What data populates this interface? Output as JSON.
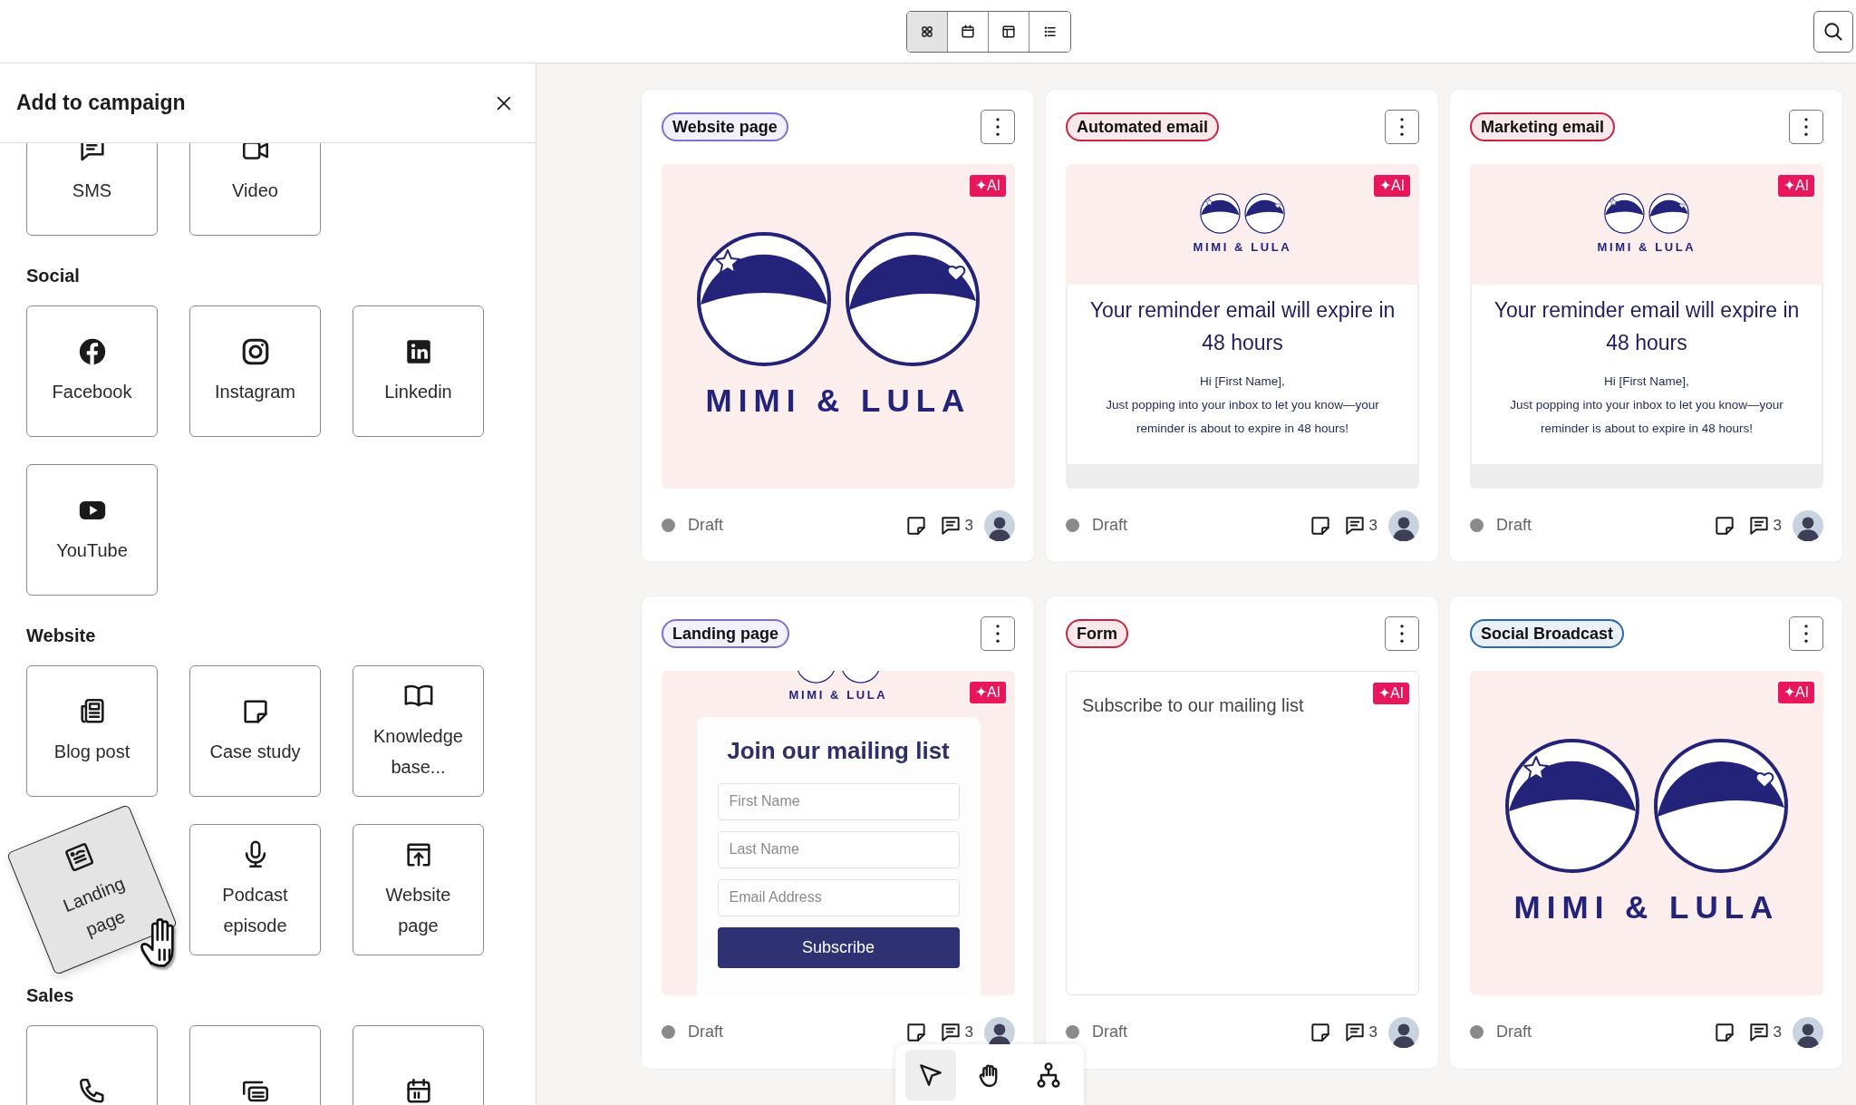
{
  "view_switcher": [
    {
      "selected": true
    },
    {
      "selected": false
    },
    {
      "selected": false
    },
    {
      "selected": false
    }
  ],
  "panel": {
    "title": "Add to campaign",
    "sections": [
      {
        "items": [
          {
            "label": "SMS",
            "dragging": false
          },
          {
            "label": "Video",
            "dragging": false
          }
        ]
      },
      {
        "title": "Social",
        "items": [
          {
            "label": "Facebook",
            "dragging": false
          },
          {
            "label": "Instagram",
            "dragging": false
          },
          {
            "label": "Linkedin",
            "dragging": false
          },
          {
            "label": "YouTube",
            "dragging": false
          }
        ]
      },
      {
        "title": "Website",
        "items": [
          {
            "label": "Blog post",
            "dragging": false
          },
          {
            "label": "Case study",
            "dragging": false
          },
          {
            "label": "Knowledge base...",
            "dragging": false
          },
          {
            "label": "Landing page",
            "dragging": true
          },
          {
            "label": "Podcast episode",
            "dragging": false
          },
          {
            "label": "Website page",
            "dragging": false
          }
        ]
      },
      {
        "title": "Sales",
        "items": [
          {
            "dragging": false
          },
          {
            "dragging": false
          },
          {
            "dragging": false
          }
        ]
      }
    ]
  },
  "cards": [
    {
      "tag": {
        "label": "Website page",
        "color": "#7b6fd8"
      },
      "ai_badge": "✦AI",
      "preview": {
        "kind": "logo",
        "logo_text": "MIMI & LULA"
      },
      "status": "Draft",
      "comments": "3"
    },
    {
      "tag": {
        "label": "Automated email",
        "color": "#c8243f"
      },
      "ai_badge": "✦AI",
      "preview": {
        "kind": "email",
        "logo_text": "MIMI & LULA",
        "heading": "Your reminder email will expire in 48 hours",
        "greeting": "Hi [First Name],",
        "body": "Just popping into your inbox to let you know—your reminder is about to expire in 48 hours!"
      },
      "status": "Draft",
      "comments": "3"
    },
    {
      "tag": {
        "label": "Marketing email",
        "color": "#c8243f"
      },
      "ai_badge": "✦AI",
      "preview": {
        "kind": "email",
        "logo_text": "MIMI & LULA",
        "heading": "Your reminder email will expire in 48 hours",
        "greeting": "Hi [First Name],",
        "body": "Just popping into your inbox to let you know—your reminder is about to expire in 48 hours!"
      },
      "status": "Draft",
      "comments": "3"
    },
    {
      "tag": {
        "label": "Landing page",
        "color": "#7b6fd8"
      },
      "ai_badge": "✦AI",
      "preview": {
        "kind": "landing",
        "logo_text": "MIMI & LULA",
        "heading": "Join our mailing list",
        "fields": [
          {
            "placeholder": "First Name"
          },
          {
            "placeholder": "Last Name"
          },
          {
            "placeholder": "Email Address"
          }
        ],
        "button": "Subscribe"
      },
      "status": "Draft",
      "comments": "3"
    },
    {
      "tag": {
        "label": "Form",
        "color": "#c8243f"
      },
      "ai_badge": "✦AI",
      "preview": {
        "kind": "form",
        "text": "Subscribe to our mailing list"
      },
      "status": "Draft",
      "comments": "3"
    },
    {
      "tag": {
        "label": "Social Broadcast",
        "color": "#2a68b0"
      },
      "ai_badge": "✦AI",
      "preview": {
        "kind": "logo",
        "logo_text": "MIMI & LULA"
      },
      "status": "Draft",
      "comments": "3"
    }
  ],
  "canvas_tools": [
    {
      "selected": true
    },
    {
      "selected": false
    },
    {
      "selected": false
    }
  ]
}
